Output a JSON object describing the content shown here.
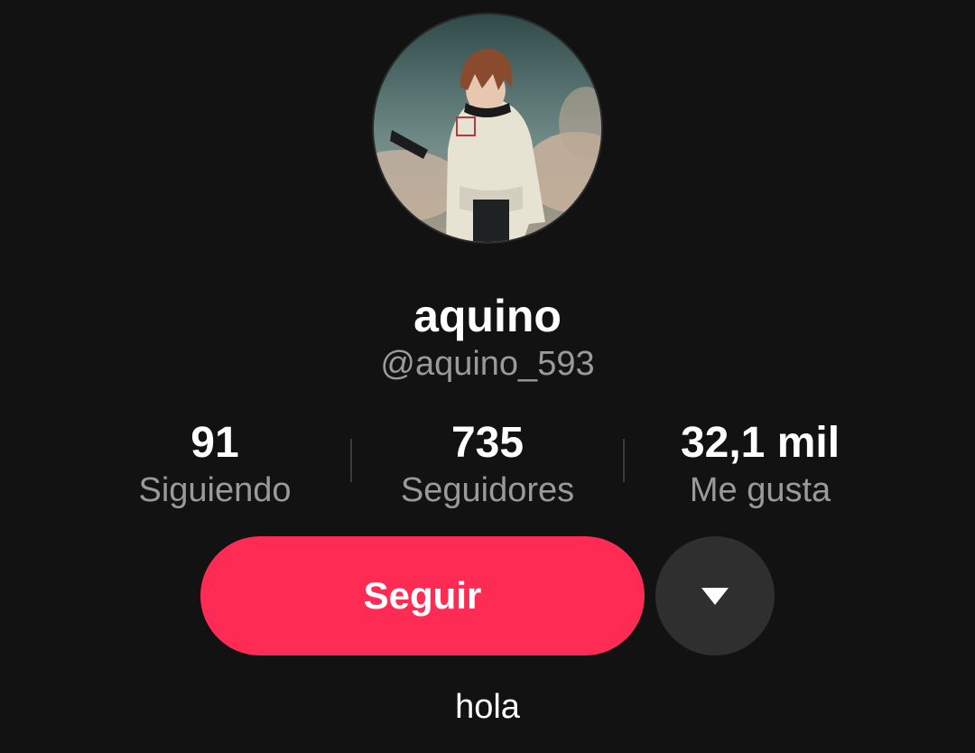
{
  "profile": {
    "avatar_alt": "anime character avatar",
    "display_name": "aquino",
    "username": "@aquino_593",
    "bio": "hola"
  },
  "stats": [
    {
      "value": "91",
      "label": "Siguiendo"
    },
    {
      "value": "735",
      "label": "Seguidores"
    },
    {
      "value": "32,1 mil",
      "label": "Me gusta"
    }
  ],
  "actions": {
    "follow_label": "Seguir",
    "more_icon": "chevron-down-icon"
  },
  "colors": {
    "background": "#121212",
    "accent": "#fe2c55",
    "secondary_button": "#2f2f2f",
    "muted_text": "#9a9a9a"
  }
}
